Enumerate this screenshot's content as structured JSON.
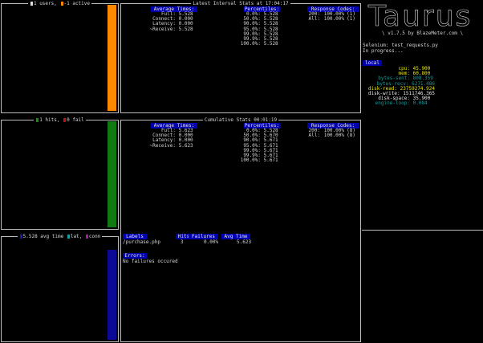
{
  "widgets": {
    "users": {
      "title_pre": "1 users,",
      "title_post": "-1 active",
      "swatch1": "#e0e0e0",
      "swatch2": "#ff8800",
      "bar_color": "#ff8800",
      "bar_fill": 1.0
    },
    "hits": {
      "title_pre": "1 hits,",
      "title_post": "0 fail",
      "swatch1": "#1a8a1a",
      "swatch2": "#c01010",
      "bar_color": "#0f7a0f",
      "bar_fill": 1.0
    },
    "avg": {
      "title_1": "5.528 avg time",
      "title_2": "lat,",
      "title_3": "conn",
      "swatch1": "#1a1ab0",
      "swatch2": "#14a0a0",
      "swatch3": "#a020a0",
      "bar_color": "#0a0a96",
      "bar_fill": 1.0
    }
  },
  "latest": {
    "title": "Latest Interval Stats at 17:04:17",
    "avg_header": "Average Times:",
    "avg_rows": [
      {
        "label": "Full:",
        "value": "5.528"
      },
      {
        "label": "Connect:",
        "value": "0.000"
      },
      {
        "label": "Latency:",
        "value": "0.000"
      },
      {
        "label": "~Receive:",
        "value": "5.528"
      }
    ],
    "pct_header": "Percentiles:",
    "pct_rows": [
      {
        "label": "0.0%:",
        "value": "5.528"
      },
      {
        "label": "50.0%:",
        "value": "5.528"
      },
      {
        "label": "90.0%:",
        "value": "5.528"
      },
      {
        "label": "95.0%:",
        "value": "5.528"
      },
      {
        "label": "99.0%:",
        "value": "5.528"
      },
      {
        "label": "99.9%:",
        "value": "5.528"
      },
      {
        "label": "100.0%:",
        "value": "5.528"
      }
    ],
    "rc_header": "Response Codes:",
    "rc_rows": [
      {
        "code": "200:",
        "pct": "100.00%",
        "count": "(1)"
      },
      {
        "code": "All:",
        "pct": "100.00%",
        "count": "(1)"
      }
    ]
  },
  "cumulative": {
    "title": "Cumulative Stats 00:01:19",
    "avg_header": "Average Times:",
    "avg_rows": [
      {
        "label": "Full:",
        "value": "5.623"
      },
      {
        "label": "Connect:",
        "value": "0.000"
      },
      {
        "label": "Latency:",
        "value": "0.000"
      },
      {
        "label": "~Receive:",
        "value": "5.623"
      }
    ],
    "pct_header": "Percentiles:",
    "pct_rows": [
      {
        "label": "0.0%:",
        "value": "5.528"
      },
      {
        "label": "50.0%:",
        "value": "5.670"
      },
      {
        "label": "90.0%:",
        "value": "5.671"
      },
      {
        "label": "95.0%:",
        "value": "5.671"
      },
      {
        "label": "99.0%:",
        "value": "5.671"
      },
      {
        "label": "99.9%:",
        "value": "5.671"
      },
      {
        "label": "100.0%:",
        "value": "5.671"
      }
    ],
    "rc_header": "Response Codes:",
    "rc_rows": [
      {
        "code": "200:",
        "pct": "100.00%",
        "count": "(8)"
      },
      {
        "code": "All:",
        "pct": "100.00%",
        "count": "(8)"
      }
    ],
    "labels_table": {
      "headers": [
        "Labels",
        "Hits",
        "Failures",
        "Avg Time"
      ],
      "row": {
        "label": "/purchase.php",
        "hits": "3",
        "failures": "0.00%",
        "avg": "5.623"
      }
    },
    "errors_header": "Errors:",
    "errors_text": "No failures occured"
  },
  "sidebar": {
    "logo": "Taurus",
    "version": "\\ v1.7.5 by BlazeMeter.com \\",
    "executor": "Selenium: test_requests.py",
    "status": "In progress...",
    "local_header": "local",
    "metrics": [
      {
        "name": "cpu:",
        "value": "45.900",
        "color": "#e8e800"
      },
      {
        "name": "mem:",
        "value": "60.800",
        "color": "#e8e800"
      },
      {
        "name": "bytes-sent:",
        "value": "808.359",
        "color": "#159a9a"
      },
      {
        "name": "bytes-recv:",
        "value": "6271.486",
        "color": "#159a9a"
      },
      {
        "name": "disk-read:",
        "value": "23759274.924",
        "color": "#e8e800"
      },
      {
        "name": "disk-write:",
        "value": "1511746.365",
        "color": "#e6e6e6"
      },
      {
        "name": "disk-space:",
        "value": "35.900",
        "color": "#e6e6e6"
      },
      {
        "name": "engine-loop:",
        "value": "0.084",
        "color": "#159a9a"
      }
    ]
  }
}
